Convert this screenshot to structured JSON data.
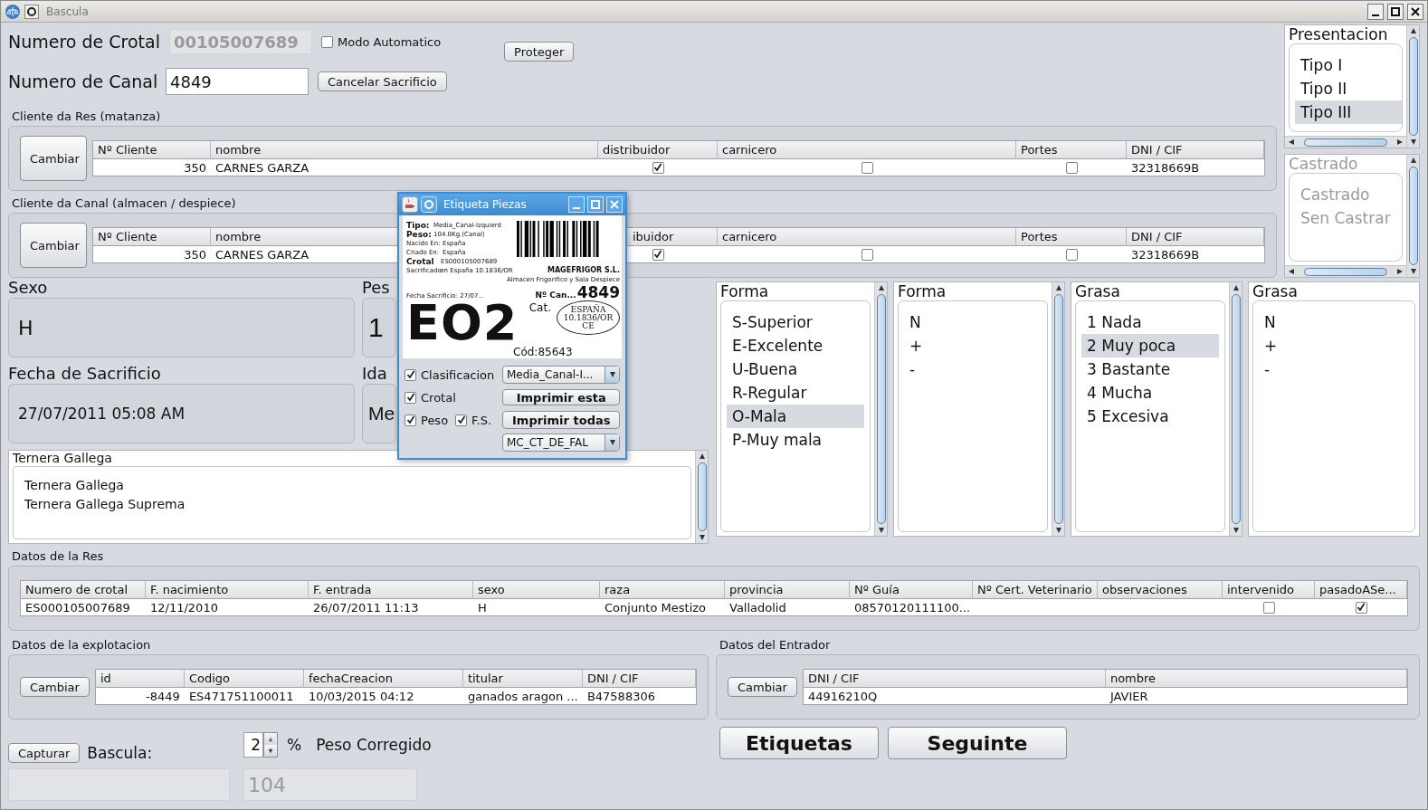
{
  "window": {
    "title": "Bascula"
  },
  "crotal": {
    "label": "Numero de Crotal",
    "value": "00105007689",
    "disabled": true
  },
  "modo_automatico": {
    "label": "Modo Automatico",
    "checked": false
  },
  "proteger_button": "Proteger",
  "canal": {
    "label": "Numero de Canal",
    "value": "4849"
  },
  "cancelar_button": "Cancelar Sacrificio",
  "clients": [
    {
      "title": "Cliente da Res (matanza)",
      "button": "Cambiar",
      "columns": [
        "Nº Cliente",
        "nombre",
        "distribuidor",
        "carnicero",
        "Portes",
        "DNI / CIF"
      ],
      "row": [
        "350",
        "CARNES GARZA",
        {
          "checked": true
        },
        {
          "checked": false
        },
        {
          "checked": false
        },
        "32318669B"
      ]
    },
    {
      "title": "Cliente da Canal (almacen / despiece)",
      "button": "Cambiar",
      "columns": [
        "Nº Cliente",
        "nombre",
        "ibuidor",
        "carnicero",
        "Portes",
        "DNI / CIF"
      ],
      "row": [
        "350",
        "CARNES GARZA",
        {
          "checked": true
        },
        {
          "checked": false
        },
        {
          "checked": false
        },
        "32318669B"
      ]
    }
  ],
  "presentacion": {
    "title": "Presentacion",
    "disabled": false,
    "items": [
      {
        "label": "Tipo I",
        "selected": false
      },
      {
        "label": "Tipo II",
        "selected": false
      },
      {
        "label": "Tipo III",
        "selected": true
      }
    ]
  },
  "castrado": {
    "title": "Castrado",
    "disabled": true,
    "items": [
      {
        "label": "Castrado",
        "selected": false
      },
      {
        "label": "Sen Castrar",
        "selected": false
      }
    ]
  },
  "fields": [
    {
      "label": "Sexo",
      "value": "H"
    },
    {
      "label": "Pes",
      "value": "1"
    },
    {
      "label": "Fecha de Sacrificio",
      "value": "27/07/2011 05:08 AM"
    },
    {
      "label": "Ida",
      "value": "Me"
    }
  ],
  "raza_list": {
    "title": "Ternera Gallega",
    "items": [
      {
        "label": "Ternera Gallega",
        "selected": false
      },
      {
        "label": "Ternera Gallega Suprema",
        "selected": false
      }
    ]
  },
  "grade_lists": [
    {
      "title": "Forma",
      "scrollbar": true,
      "items": [
        {
          "label": "S-Superior",
          "selected": false
        },
        {
          "label": "E-Excelente",
          "selected": false
        },
        {
          "label": "U-Buena",
          "selected": false
        },
        {
          "label": "R-Regular",
          "selected": false
        },
        {
          "label": "O-Mala",
          "selected": true
        },
        {
          "label": "P-Muy mala",
          "selected": false
        }
      ]
    },
    {
      "title": "Forma",
      "scrollbar": true,
      "items": [
        {
          "label": "N",
          "selected": false
        },
        {
          "label": "+",
          "selected": false
        },
        {
          "label": "-",
          "selected": false
        }
      ]
    },
    {
      "title": "Grasa",
      "scrollbar": true,
      "items": [
        {
          "label": "1 Nada",
          "selected": false
        },
        {
          "label": "2 Muy poca",
          "selected": true
        },
        {
          "label": "3 Bastante",
          "selected": false
        },
        {
          "label": "4 Mucha",
          "selected": false
        },
        {
          "label": "5 Excesiva",
          "selected": false
        }
      ]
    },
    {
      "title": "Grasa",
      "scrollbar": false,
      "items": [
        {
          "label": "N",
          "selected": false
        },
        {
          "label": "+",
          "selected": false
        },
        {
          "label": "-",
          "selected": false
        }
      ]
    }
  ],
  "res": {
    "title": "Datos de la Res",
    "columns": [
      "Numero de crotal",
      "F. nacimiento",
      "F. entrada",
      "sexo",
      "raza",
      "provincia",
      "Nº Guía",
      "Nº Cert. Veterinario",
      "observaciones",
      "intervenido",
      "pasadoASe..."
    ],
    "row": [
      "ES000105007689",
      "12/11/2010",
      "26/07/2011 11:13",
      "H",
      "Conjunto Mestizo",
      "Valladolid",
      "08570120111100...",
      {
        "kind": "empty"
      },
      {
        "kind": "empty"
      },
      {
        "checked": false
      },
      {
        "checked": true
      }
    ]
  },
  "explotacion": {
    "title": "Datos de la explotacion",
    "button": "Cambiar",
    "columns": [
      "id",
      "Codigo",
      "fechaCreacion",
      "titular",
      "DNI / CIF"
    ],
    "row": [
      "-8449",
      "ES471751100011",
      "10/03/2015 04:12",
      "ganados aragon ...",
      "B47588306"
    ]
  },
  "entrador": {
    "title": "Datos del Entrador",
    "button": "Cambiar",
    "columns": [
      "DNI / CIF",
      "nombre"
    ],
    "row": [
      "44916210Q",
      "JAVIER"
    ]
  },
  "bottom": {
    "capturar_button": "Capturar",
    "bascula_label": "Bascula:",
    "spinner_value": "2",
    "percent": "%",
    "peso_label": "Peso Corregido",
    "peso_value": "104",
    "etiquetas_button": "Etiquetas",
    "seguinte_button": "Seguinte"
  },
  "popup": {
    "title": "Etiqueta Piezas",
    "label": {
      "tipo_key": "Tipo:",
      "tipo": "Media_Canal-Izquierd",
      "peso_key": "Peso:",
      "peso": "104.0Kg.(Canal)",
      "nacido_key": "Nacido En:",
      "nacido": "España",
      "criado_key": "Criado En:",
      "criado": "España",
      "crotal_key": "Crotal",
      "crotal": "ES000105007689",
      "sacrificado": "Sacrificadœn España 10.1836/OR",
      "company": "MAGEFRIGOR S.L.",
      "company_sub": "Almacen Frigorifico y Sala Despiece",
      "fecha": "Fecha Sacrificio: 27/07...",
      "canal_key": "Nº Can...",
      "canal": "4849",
      "grade": "EO2",
      "cat": "Cat.",
      "stamp": [
        "ESPAÑA",
        "10.1836/OR",
        "CE"
      ],
      "cod": "Cód:85643"
    },
    "checks": [
      {
        "label": "Clasificacion",
        "checked": true
      },
      {
        "label": "Crotal",
        "checked": true
      },
      {
        "label": "Peso",
        "checked": true
      },
      {
        "label": "F.S.",
        "checked": true
      }
    ],
    "combo_1": "Media_Canal-I...",
    "imprimir_esta": "Imprimir esta",
    "imprimir_todas": "Imprimir todas",
    "combo_2": "MC_CT_DE_FAL"
  }
}
